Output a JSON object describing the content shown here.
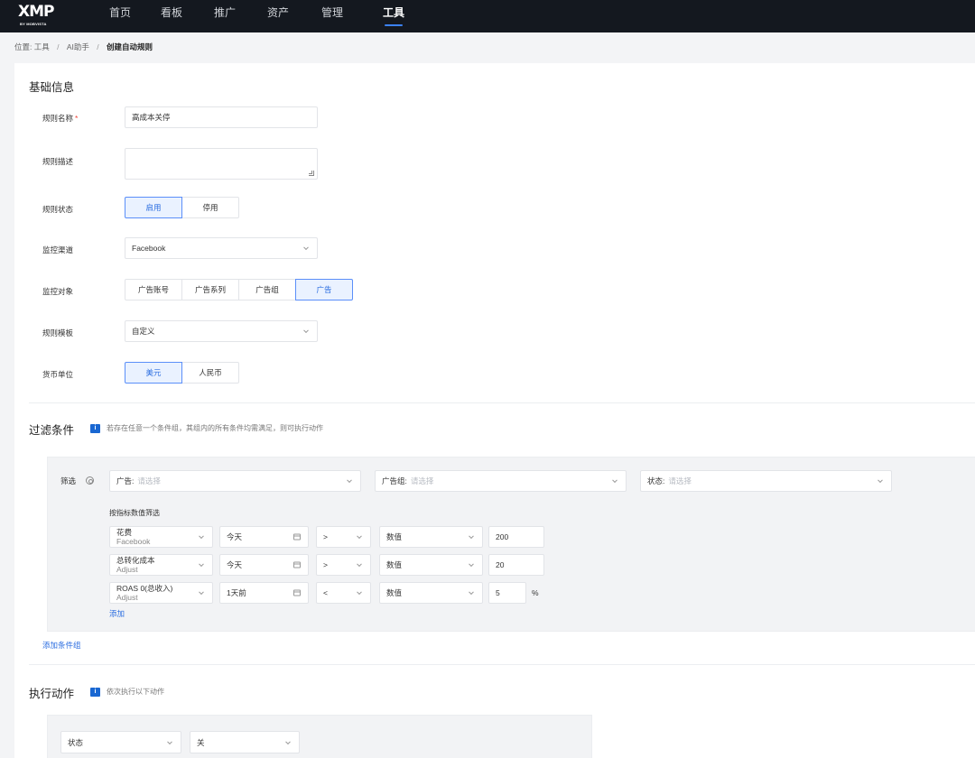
{
  "topbar": {
    "logo_main": "XMP",
    "logo_sub": "BY MOBVISTA",
    "nav": [
      "首页",
      "看板",
      "推广",
      "资产",
      "管理",
      "工具"
    ]
  },
  "breadcrumb": {
    "prefix": "位置:",
    "items": [
      "工具",
      "AI助手"
    ],
    "current": "创建自动规则"
  },
  "basic": {
    "title": "基础信息",
    "rule_name_label": "规则名称",
    "rule_name_required": "*",
    "rule_name_value": "高成本关停",
    "rule_desc_label": "规则描述",
    "rule_status_label": "规则状态",
    "rule_status_options": [
      "启用",
      "停用"
    ],
    "channel_label": "监控渠道",
    "channel_value": "Facebook",
    "object_label": "监控对象",
    "object_options": [
      "广告账号",
      "广告系列",
      "广告组",
      "广告"
    ],
    "template_label": "规则模板",
    "template_value": "自定义",
    "currency_label": "货币单位",
    "currency_options": [
      "美元",
      "人民币"
    ]
  },
  "filter": {
    "title": "过滤条件",
    "info_icon": "i",
    "hint": "若存在任意一个条件组，其组内的所有条件均需满足，则可执行动作",
    "filter_label": "筛选",
    "ad_prefix": "广告:",
    "ad_placeholder": "请选择",
    "adgroup_prefix": "广告组:",
    "adgroup_placeholder": "请选择",
    "status_prefix": "状态:",
    "status_placeholder": "请选择",
    "metric_title": "按指标数值筛选",
    "rows": [
      {
        "metric": "花费",
        "source": "Facebook",
        "date": "今天",
        "op": ">",
        "type": "数值",
        "value": "200",
        "unit": ""
      },
      {
        "metric": "总转化成本",
        "source": "Adjust",
        "date": "今天",
        "op": ">",
        "type": "数值",
        "value": "20",
        "unit": ""
      },
      {
        "metric": "ROAS 0(总收入)",
        "source": "Adjust",
        "date": "1天前",
        "op": "<",
        "type": "数值",
        "value": "5",
        "unit": "%"
      }
    ],
    "add_label": "添加",
    "add_group_label": "添加条件组"
  },
  "action": {
    "title": "执行动作",
    "info_icon": "i",
    "hint": "依次执行以下动作",
    "field_value": "状态",
    "state_value": "关"
  },
  "colors": {
    "topbar_bg": "#14181f",
    "accent": "#2b6de0",
    "active_bg": "#eaf2ff",
    "required": "#f04438"
  }
}
